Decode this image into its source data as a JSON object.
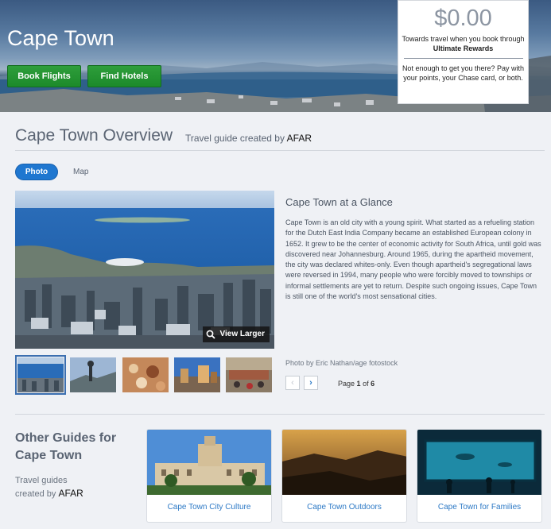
{
  "hero": {
    "title": "Cape Town",
    "book_flights": "Book Flights",
    "find_hotels": "Find Hotels"
  },
  "rewards": {
    "amount": "$0.00",
    "towards": "Towards travel when you book through",
    "program": "Ultimate Rewards",
    "note": "Not enough to get you there? Pay with your points, your Chase card, or both."
  },
  "overview": {
    "title": "Cape Town Overview",
    "subtitle_prefix": "Travel guide created by",
    "subtitle_brand": "AFAR",
    "tabs": [
      {
        "label": "Photo",
        "active": true
      },
      {
        "label": "Map",
        "active": false
      }
    ],
    "view_larger": "View Larger",
    "glance_title": "Cape Town at a Glance",
    "glance_body": "Cape Town is an old city with a young spirit. What started as a refueling station for the Dutch East India Company became an established European colony in 1652. It grew to be the center of economic activity for South Africa, until gold was discovered near Johannesburg. Around 1965, during the apartheid movement, the city was declared whites-only. Even though apartheid's segregational laws were reversed in 1994, many people who were forcibly moved to townships or informal settlements are yet to return. Despite such ongoing issues, Cape Town is still one of the world's most sensational cities.",
    "credit": "Photo by Eric Nathan/age fotostock",
    "pager": {
      "prefix": "Page",
      "current": "1",
      "of": "of",
      "total": "6"
    }
  },
  "other_guides": {
    "title": "Other Guides for Cape Town",
    "sub_prefix": "Travel guides",
    "sub_created": "created by",
    "sub_brand": "AFAR",
    "cards": [
      {
        "label": "Cape Town City Culture"
      },
      {
        "label": "Cape Town Outdoors"
      },
      {
        "label": "Cape Town for Families"
      }
    ]
  },
  "colors": {
    "accent_blue": "#1f77d0",
    "link_blue": "#2e7ac6",
    "green_button": "#2e9e3b"
  }
}
